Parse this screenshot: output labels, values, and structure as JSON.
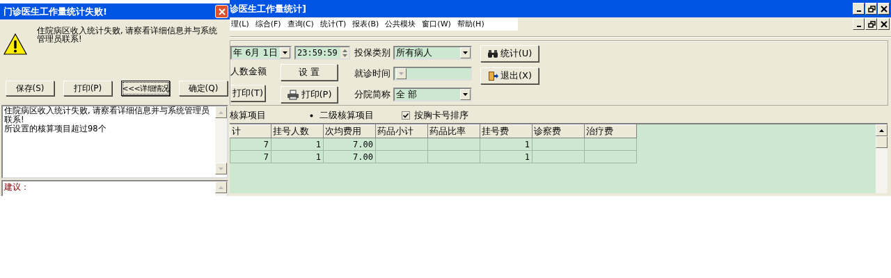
{
  "main_window": {
    "title": "诊医生工作量统计]"
  },
  "menu": [
    "理(L)",
    "综合(F)",
    "查询(C)",
    "统计(T)",
    "报表(B)",
    "公共模块",
    "窗口(W)",
    "帮助(H)"
  ],
  "toolbar": {
    "date": "年 6月 1日",
    "time": "23:59:59",
    "caption": "人数金额",
    "fields": [
      {
        "label": "投保类别",
        "value": "所有病人",
        "disabled": false
      },
      {
        "label": "就诊时间",
        "disabled": true
      },
      {
        "label": "分院简称",
        "value": "全 部",
        "disabled": false
      }
    ],
    "left_buttons": [
      {
        "label": "打印(T)"
      }
    ],
    "mid_buttons": [
      {
        "label": "设  置",
        "kind": "plain"
      },
      {
        "label": "打印(P)",
        "kind": "print"
      }
    ],
    "right_buttons": [
      {
        "label": "统计(U)",
        "kind": "search"
      },
      {
        "label": "退出(X)",
        "kind": "exit"
      }
    ]
  },
  "options": [
    {
      "kind": "text",
      "label": "核算项目"
    },
    {
      "kind": "radio",
      "label": "二级核算项目",
      "selected": true
    },
    {
      "kind": "checkbox",
      "label": "按胸卡号排序",
      "checked": true
    }
  ],
  "table": {
    "columns": [
      "计",
      "挂号人数",
      "次均费用",
      "药品小计",
      "药品比率",
      "挂号费",
      "诊察费",
      "治疗费"
    ],
    "rows": [
      [
        "7",
        "1",
        "7.00",
        "",
        "",
        "1",
        "",
        ""
      ],
      [
        "7",
        "1",
        "7.00",
        "",
        "",
        "1",
        "",
        ""
      ]
    ]
  },
  "dialog": {
    "title": "门诊医生工作量统计失败!",
    "message": "住院病区收入统计失败, 请察看详细信息并与系统管理员联系!",
    "buttons": [
      {
        "label": "保存(S)",
        "focused": false
      },
      {
        "label": "打印(P)",
        "focused": false
      },
      {
        "label": "<<<详细情况",
        "focused": true
      },
      {
        "label": "确定(Q)",
        "focused": false
      }
    ],
    "details": [
      "住院病区收入统计失败, 请察看详细信息并与系统管理员联系!",
      "所设置的核算项目超过98个"
    ],
    "suggestion": "建议："
  }
}
